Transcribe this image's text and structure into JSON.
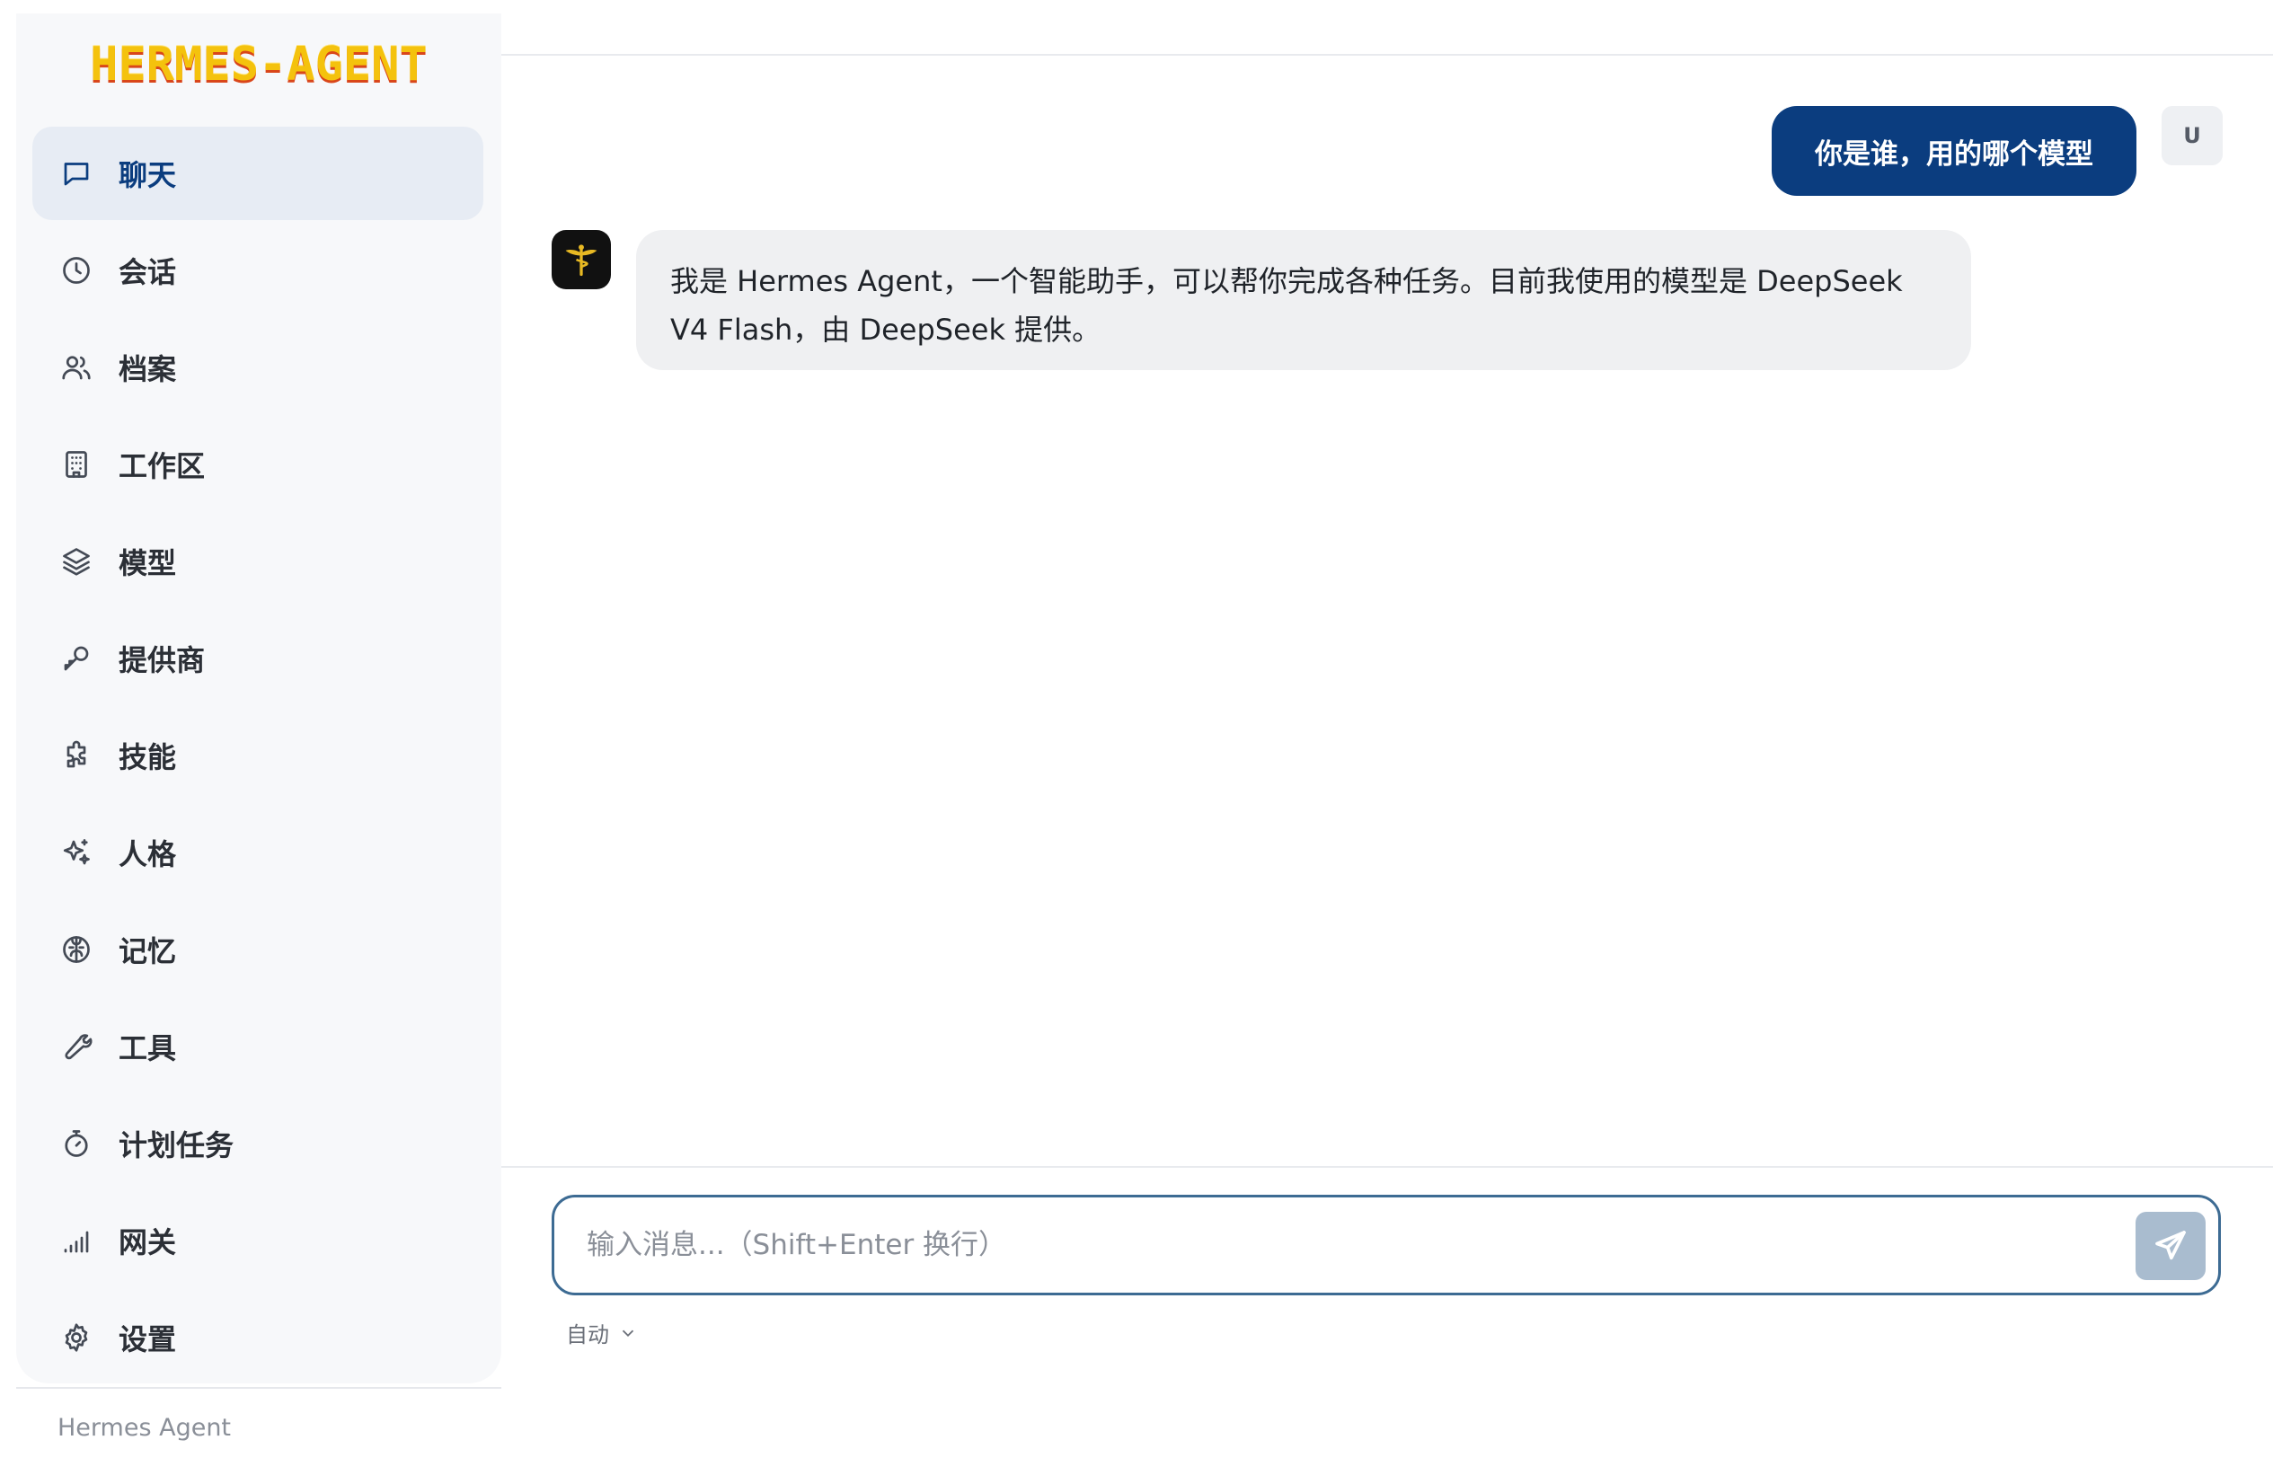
{
  "app": {
    "logo_text": "HERMES-AGENT",
    "footer": "Hermes Agent"
  },
  "sidebar": {
    "items": [
      {
        "label": "聊天",
        "icon": "chat-bubble-icon",
        "active": true
      },
      {
        "label": "会话",
        "icon": "clock-icon"
      },
      {
        "label": "档案",
        "icon": "users-icon"
      },
      {
        "label": "工作区",
        "icon": "building-icon"
      },
      {
        "label": "模型",
        "icon": "layers-icon"
      },
      {
        "label": "提供商",
        "icon": "key-icon"
      },
      {
        "label": "技能",
        "icon": "puzzle-icon"
      },
      {
        "label": "人格",
        "icon": "sparkles-icon"
      },
      {
        "label": "记忆",
        "icon": "brain-icon"
      },
      {
        "label": "工具",
        "icon": "wrench-icon"
      },
      {
        "label": "计划任务",
        "icon": "timer-icon"
      },
      {
        "label": "网关",
        "icon": "signal-icon"
      },
      {
        "label": "设置",
        "icon": "gear-icon"
      }
    ]
  },
  "chat": {
    "user_avatar": "U",
    "messages": [
      {
        "role": "user",
        "text": "你是谁，用的哪个模型"
      },
      {
        "role": "assistant",
        "text": "我是 Hermes Agent，一个智能助手，可以帮你完成各种任务。目前我使用的模型是 DeepSeek V4 Flash，由 DeepSeek 提供。"
      }
    ]
  },
  "composer": {
    "placeholder": "输入消息...（Shift+Enter 换行）",
    "mode_label": "自动"
  },
  "colors": {
    "accent": "#0b3d7f",
    "logo": "#f4c20d",
    "send_button": "#a9bccf"
  }
}
